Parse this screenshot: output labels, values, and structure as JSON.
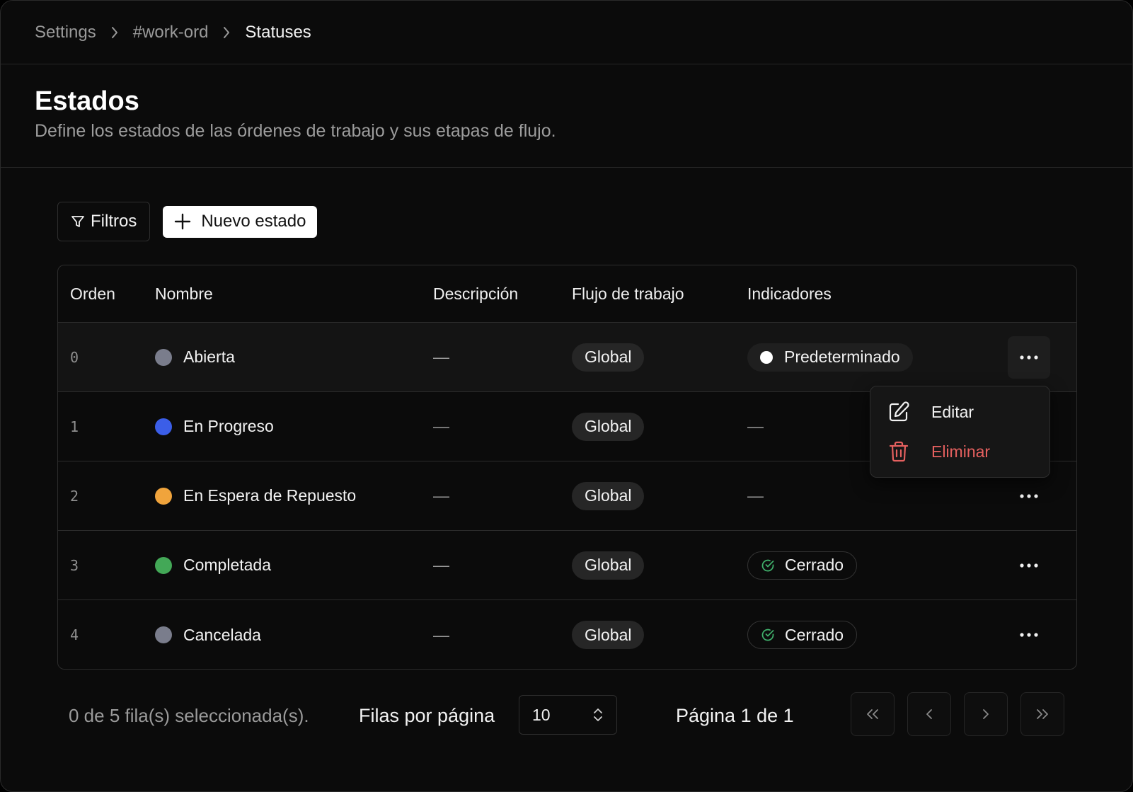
{
  "breadcrumb": {
    "items": [
      "Settings",
      "#work-ord",
      "Statuses"
    ]
  },
  "header": {
    "title": "Estados",
    "subtitle": "Define los estados de las órdenes de trabajo y sus etapas de flujo."
  },
  "toolbar": {
    "filter_label": "Filtros",
    "new_label": "Nuevo estado"
  },
  "table": {
    "columns": [
      "Orden",
      "Nombre",
      "Descripción",
      "Flujo de trabajo",
      "Indicadores"
    ],
    "rows": [
      {
        "order": "0",
        "name": "Abierta",
        "color": "#7a7d8c",
        "description": "—",
        "workflow": "Global",
        "indicator": "Predeterminado",
        "indicator_type": "default"
      },
      {
        "order": "1",
        "name": "En Progreso",
        "color": "#3b5ee8",
        "description": "—",
        "workflow": "Global",
        "indicator": "—",
        "indicator_type": "none"
      },
      {
        "order": "2",
        "name": "En Espera de Repuesto",
        "color": "#f0a43c",
        "description": "—",
        "workflow": "Global",
        "indicator": "—",
        "indicator_type": "none"
      },
      {
        "order": "3",
        "name": "Completada",
        "color": "#43a857",
        "description": "—",
        "workflow": "Global",
        "indicator": "Cerrado",
        "indicator_type": "closed"
      },
      {
        "order": "4",
        "name": "Cancelada",
        "color": "#7a7d8c",
        "description": "—",
        "workflow": "Global",
        "indicator": "Cerrado",
        "indicator_type": "closed"
      }
    ]
  },
  "context_menu": {
    "edit_label": "Editar",
    "delete_label": "Eliminar"
  },
  "footer": {
    "selection_text": "0 de 5 fila(s) seleccionada(s).",
    "rows_per_page_label": "Filas por página",
    "rows_per_page_value": "10",
    "page_text": "Página 1 de 1"
  },
  "colors": {
    "delete": "#e5605f",
    "check": "#3fae6a"
  },
  "icons": {
    "filter": "filter-icon",
    "plus": "plus-icon",
    "more": "more-horizontal-icon",
    "edit": "edit-icon",
    "delete": "trash-icon",
    "check": "check-circle-icon"
  }
}
